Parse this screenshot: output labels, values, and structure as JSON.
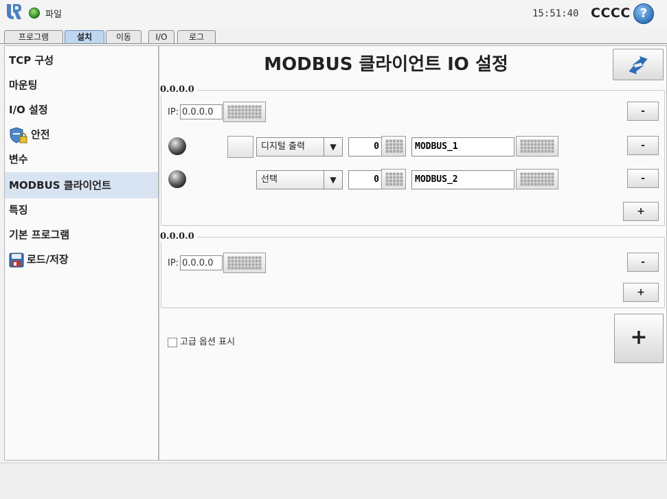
{
  "header": {
    "file_label": "파일",
    "clock": "15:51:40",
    "robot_name": "CCCC",
    "help_symbol": "?",
    "status_color": "#2a8a1a"
  },
  "tabs": [
    {
      "label": "프로그램",
      "active": false
    },
    {
      "label": "설치",
      "active": true
    },
    {
      "label": "이동",
      "active": false
    },
    {
      "label": "I/O",
      "active": false
    },
    {
      "label": "로그",
      "active": false
    }
  ],
  "sidebar": {
    "items": [
      {
        "label": "TCP 구성"
      },
      {
        "label": "마운팅"
      },
      {
        "label": "I/O 설정"
      },
      {
        "label": "안전",
        "icon": "safety-shield-icon"
      },
      {
        "label": "변수"
      },
      {
        "label": "MODBUS 클라이언트",
        "active": true
      },
      {
        "label": "특징"
      },
      {
        "label": "기본 프로그램"
      },
      {
        "label": "로드/저장",
        "icon": "floppy-disk-icon"
      }
    ]
  },
  "main": {
    "title": "MODBUS 클라이언트 IO 설정",
    "groups": [
      {
        "title": "0.0.0.0",
        "ip_label": "IP:",
        "ip_value": "0.0.0.0",
        "signals": [
          {
            "type": "디지털 출력",
            "address": "0",
            "name": "MODBUS_1"
          },
          {
            "type": "선택",
            "address": "0",
            "name": "MODBUS_2"
          }
        ],
        "minus_label": "-",
        "plus_label": "+"
      },
      {
        "title": "0.0.0.0",
        "ip_label": "IP:",
        "ip_value": "0.0.0.0",
        "minus_label": "-",
        "plus_label": "+"
      }
    ],
    "advanced_label": "고급 옵션 표시",
    "add_label": "+"
  }
}
